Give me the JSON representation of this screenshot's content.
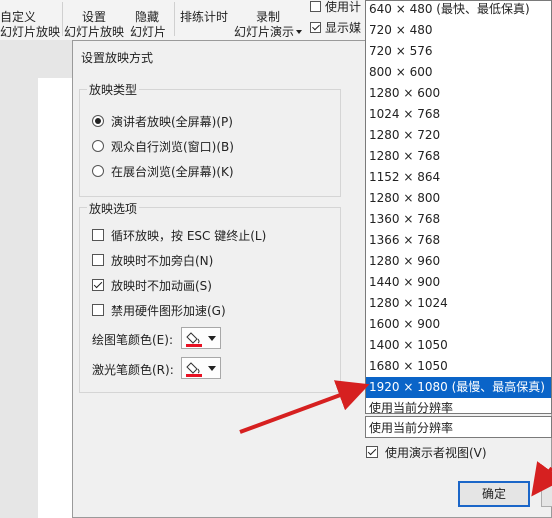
{
  "ribbon": {
    "custom_show_line1": "自定义",
    "custom_show_line2": "幻灯片放映",
    "setup_line1": "设置",
    "setup_line2": "幻灯片放映",
    "hide_line1": "隐藏",
    "hide_line2": "幻灯片",
    "rehearse": "排练计时",
    "record_line1": "录制",
    "record_line2": "幻灯片演示",
    "use_timing": "使用计",
    "show_media": "显示媒"
  },
  "dialog": {
    "title": "设置放映方式",
    "show_type": {
      "title": "放映类型",
      "options": [
        "演讲者放映(全屏幕)(P)",
        "观众自行浏览(窗口)(B)",
        "在展台浏览(全屏幕)(K)"
      ],
      "selected_index": 0
    },
    "show_options": {
      "title": "放映选项",
      "items": [
        {
          "label": "循环放映，按 ESC 键终止(L)",
          "checked": false
        },
        {
          "label": "放映时不加旁白(N)",
          "checked": false
        },
        {
          "label": "放映时不加动画(S)",
          "checked": true
        },
        {
          "label": "禁用硬件图形加速(G)",
          "checked": false
        }
      ],
      "pen_color_label": "绘图笔颜色(E):",
      "laser_color_label": "激光笔颜色(R):",
      "pen_color": "#e81123",
      "laser_color": "#e81123"
    },
    "resolution": {
      "options": [
        "640 × 480 (最快、最低保真)",
        "720 × 480",
        "720 × 576",
        "800 × 600",
        "1280 × 600",
        "1024 × 768",
        "1280 × 720",
        "1280 × 768",
        "1152 × 864",
        "1280 × 800",
        "1360 × 768",
        "1366 × 768",
        "1280 × 960",
        "1440 × 900",
        "1280 × 1024",
        "1600 × 900",
        "1400 × 1050",
        "1680 × 1050",
        "1920 × 1080 (最慢、最高保真)",
        "使用当前分辨率"
      ],
      "selected_index": 18,
      "combo_value": "使用当前分辨率"
    },
    "presenter_view": {
      "label": "使用演示者视图(V)",
      "checked": true
    },
    "ok_label": "确定"
  },
  "annotations": {
    "arrow_color": "#d62020"
  }
}
